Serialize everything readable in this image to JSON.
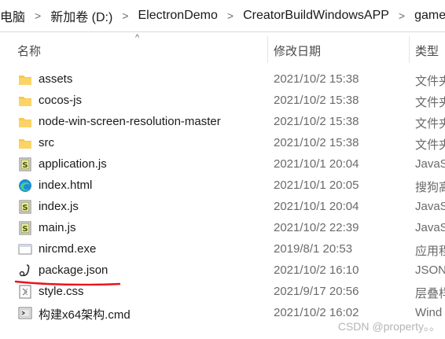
{
  "breadcrumb": [
    "电脑",
    "新加卷 (D:)",
    "ElectronDemo",
    "CreatorBuildWindowsAPP",
    "game"
  ],
  "separator": ">",
  "columns": {
    "name": "名称",
    "date": "修改日期",
    "type": "类型"
  },
  "sort_arrow": "^",
  "files": [
    {
      "name": "assets",
      "date": "2021/10/2 15:38",
      "type": "文件夹",
      "icon": "folder-icon"
    },
    {
      "name": "cocos-js",
      "date": "2021/10/2 15:38",
      "type": "文件夹",
      "icon": "folder-icon"
    },
    {
      "name": "node-win-screen-resolution-master",
      "date": "2021/10/2 15:38",
      "type": "文件夹",
      "icon": "folder-icon"
    },
    {
      "name": "src",
      "date": "2021/10/2 15:38",
      "type": "文件夹",
      "icon": "folder-icon"
    },
    {
      "name": "application.js",
      "date": "2021/10/1 20:04",
      "type": "JavaS",
      "icon": "js-file-icon"
    },
    {
      "name": "index.html",
      "date": "2021/10/1 20:05",
      "type": "搜狗高",
      "icon": "browser-html-icon"
    },
    {
      "name": "index.js",
      "date": "2021/10/1 20:04",
      "type": "JavaS",
      "icon": "js-file-icon"
    },
    {
      "name": "main.js",
      "date": "2021/10/2 22:39",
      "type": "JavaS",
      "icon": "js-file-icon"
    },
    {
      "name": "nircmd.exe",
      "date": "2019/8/1 20:53",
      "type": "应用程",
      "icon": "exe-file-icon"
    },
    {
      "name": "package.json",
      "date": "2021/10/2 16:10",
      "type": "JSON",
      "icon": "json-file-icon"
    },
    {
      "name": "style.css",
      "date": "2021/9/17 20:56",
      "type": "层叠样",
      "icon": "css-file-icon"
    },
    {
      "name": "构建x64架构.cmd",
      "date": "2021/10/2 16:02",
      "type": "Wind",
      "icon": "cmd-file-icon"
    }
  ],
  "highlight_color": "#e8141c",
  "folder_color": "#f8c84a",
  "watermark": "CSDN @property。。"
}
